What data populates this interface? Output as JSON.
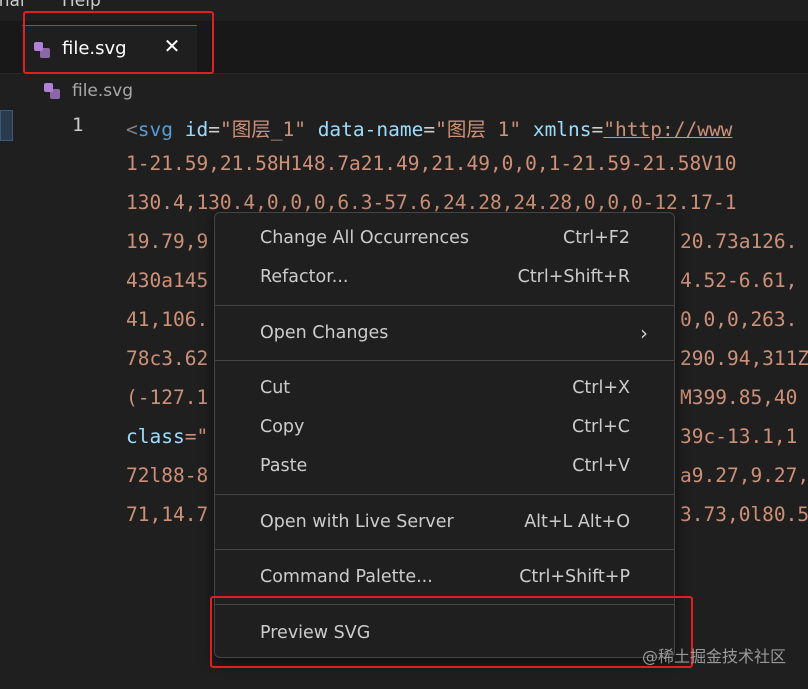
{
  "menubar": {
    "items": [
      "inal",
      "Help"
    ]
  },
  "tab": {
    "label": "file.svg",
    "close_icon": "✕",
    "icon": "svg-file-icon"
  },
  "breadcrumb": {
    "label": "file.svg"
  },
  "editor": {
    "line_number": "1",
    "line1": {
      "open": "<",
      "tag": "svg",
      "attr1": "id",
      "eq": "=",
      "val1": "\"图层_1\"",
      "attr2": "data-name",
      "val2": "\"图层 1\"",
      "attr3": "xmlns",
      "val3": "\"http://www"
    },
    "lines": [
      "1-21.59,21.58H148.7a21.49,21.49,0,0,1-21.59-21.58V10",
      "130.4,130.4,0,0,0,6.3-57.6,24.28,24.28,0,0,0-12.17-1",
      "19.79,9",
      "430a145",
      "41,106.",
      "78c3.62",
      "(-127.1",
      "",
      "72l88-8",
      "71,14.7"
    ],
    "right_fragments": [
      "",
      "",
      "20.73a126.",
      "4.52-6.61,",
      "0,0,0,263.",
      "290.94,311Z",
      "M399.85,40",
      "39c-13.1,1",
      "a9.27,9.27,",
      "3.73,0l80.5"
    ],
    "line_class_attr": "class",
    "line_class_eq": "=\""
  },
  "context_menu": {
    "items": [
      {
        "label": "Change All Occurrences",
        "shortcut": "Ctrl+F2"
      },
      {
        "label": "Refactor...",
        "shortcut": "Ctrl+Shift+R"
      },
      {
        "label": "Open Changes",
        "shortcut": ""
      },
      {
        "label": "Cut",
        "shortcut": "Ctrl+X"
      },
      {
        "label": "Copy",
        "shortcut": "Ctrl+C"
      },
      {
        "label": "Paste",
        "shortcut": "Ctrl+V"
      },
      {
        "label": "Open with Live Server",
        "shortcut": "Alt+L Alt+O"
      },
      {
        "label": "Command Palette...",
        "shortcut": "Ctrl+Shift+P"
      },
      {
        "label": "Preview SVG",
        "shortcut": ""
      }
    ],
    "submenu_chevron": "›"
  },
  "watermark": "@稀土掘金技术社区",
  "colors": {
    "background": "#1f1f1f",
    "highlight": "#e02020",
    "svg_icon": "#b180d7",
    "string": "#ce9178",
    "tag": "#569cd6",
    "attribute": "#9cdcfe"
  }
}
